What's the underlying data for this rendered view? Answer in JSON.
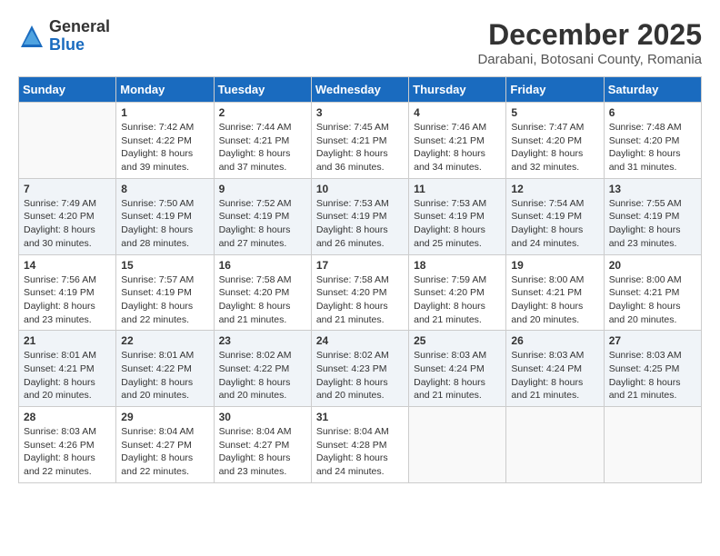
{
  "logo": {
    "general": "General",
    "blue": "Blue"
  },
  "header": {
    "month_year": "December 2025",
    "location": "Darabani, Botosani County, Romania"
  },
  "weekdays": [
    "Sunday",
    "Monday",
    "Tuesday",
    "Wednesday",
    "Thursday",
    "Friday",
    "Saturday"
  ],
  "weeks": [
    [
      {
        "day": "",
        "sunrise": "",
        "sunset": "",
        "daylight": ""
      },
      {
        "day": "1",
        "sunrise": "Sunrise: 7:42 AM",
        "sunset": "Sunset: 4:22 PM",
        "daylight": "Daylight: 8 hours and 39 minutes."
      },
      {
        "day": "2",
        "sunrise": "Sunrise: 7:44 AM",
        "sunset": "Sunset: 4:21 PM",
        "daylight": "Daylight: 8 hours and 37 minutes."
      },
      {
        "day": "3",
        "sunrise": "Sunrise: 7:45 AM",
        "sunset": "Sunset: 4:21 PM",
        "daylight": "Daylight: 8 hours and 36 minutes."
      },
      {
        "day": "4",
        "sunrise": "Sunrise: 7:46 AM",
        "sunset": "Sunset: 4:21 PM",
        "daylight": "Daylight: 8 hours and 34 minutes."
      },
      {
        "day": "5",
        "sunrise": "Sunrise: 7:47 AM",
        "sunset": "Sunset: 4:20 PM",
        "daylight": "Daylight: 8 hours and 32 minutes."
      },
      {
        "day": "6",
        "sunrise": "Sunrise: 7:48 AM",
        "sunset": "Sunset: 4:20 PM",
        "daylight": "Daylight: 8 hours and 31 minutes."
      }
    ],
    [
      {
        "day": "7",
        "sunrise": "Sunrise: 7:49 AM",
        "sunset": "Sunset: 4:20 PM",
        "daylight": "Daylight: 8 hours and 30 minutes."
      },
      {
        "day": "8",
        "sunrise": "Sunrise: 7:50 AM",
        "sunset": "Sunset: 4:19 PM",
        "daylight": "Daylight: 8 hours and 28 minutes."
      },
      {
        "day": "9",
        "sunrise": "Sunrise: 7:52 AM",
        "sunset": "Sunset: 4:19 PM",
        "daylight": "Daylight: 8 hours and 27 minutes."
      },
      {
        "day": "10",
        "sunrise": "Sunrise: 7:53 AM",
        "sunset": "Sunset: 4:19 PM",
        "daylight": "Daylight: 8 hours and 26 minutes."
      },
      {
        "day": "11",
        "sunrise": "Sunrise: 7:53 AM",
        "sunset": "Sunset: 4:19 PM",
        "daylight": "Daylight: 8 hours and 25 minutes."
      },
      {
        "day": "12",
        "sunrise": "Sunrise: 7:54 AM",
        "sunset": "Sunset: 4:19 PM",
        "daylight": "Daylight: 8 hours and 24 minutes."
      },
      {
        "day": "13",
        "sunrise": "Sunrise: 7:55 AM",
        "sunset": "Sunset: 4:19 PM",
        "daylight": "Daylight: 8 hours and 23 minutes."
      }
    ],
    [
      {
        "day": "14",
        "sunrise": "Sunrise: 7:56 AM",
        "sunset": "Sunset: 4:19 PM",
        "daylight": "Daylight: 8 hours and 23 minutes."
      },
      {
        "day": "15",
        "sunrise": "Sunrise: 7:57 AM",
        "sunset": "Sunset: 4:19 PM",
        "daylight": "Daylight: 8 hours and 22 minutes."
      },
      {
        "day": "16",
        "sunrise": "Sunrise: 7:58 AM",
        "sunset": "Sunset: 4:20 PM",
        "daylight": "Daylight: 8 hours and 21 minutes."
      },
      {
        "day": "17",
        "sunrise": "Sunrise: 7:58 AM",
        "sunset": "Sunset: 4:20 PM",
        "daylight": "Daylight: 8 hours and 21 minutes."
      },
      {
        "day": "18",
        "sunrise": "Sunrise: 7:59 AM",
        "sunset": "Sunset: 4:20 PM",
        "daylight": "Daylight: 8 hours and 21 minutes."
      },
      {
        "day": "19",
        "sunrise": "Sunrise: 8:00 AM",
        "sunset": "Sunset: 4:21 PM",
        "daylight": "Daylight: 8 hours and 20 minutes."
      },
      {
        "day": "20",
        "sunrise": "Sunrise: 8:00 AM",
        "sunset": "Sunset: 4:21 PM",
        "daylight": "Daylight: 8 hours and 20 minutes."
      }
    ],
    [
      {
        "day": "21",
        "sunrise": "Sunrise: 8:01 AM",
        "sunset": "Sunset: 4:21 PM",
        "daylight": "Daylight: 8 hours and 20 minutes."
      },
      {
        "day": "22",
        "sunrise": "Sunrise: 8:01 AM",
        "sunset": "Sunset: 4:22 PM",
        "daylight": "Daylight: 8 hours and 20 minutes."
      },
      {
        "day": "23",
        "sunrise": "Sunrise: 8:02 AM",
        "sunset": "Sunset: 4:22 PM",
        "daylight": "Daylight: 8 hours and 20 minutes."
      },
      {
        "day": "24",
        "sunrise": "Sunrise: 8:02 AM",
        "sunset": "Sunset: 4:23 PM",
        "daylight": "Daylight: 8 hours and 20 minutes."
      },
      {
        "day": "25",
        "sunrise": "Sunrise: 8:03 AM",
        "sunset": "Sunset: 4:24 PM",
        "daylight": "Daylight: 8 hours and 21 minutes."
      },
      {
        "day": "26",
        "sunrise": "Sunrise: 8:03 AM",
        "sunset": "Sunset: 4:24 PM",
        "daylight": "Daylight: 8 hours and 21 minutes."
      },
      {
        "day": "27",
        "sunrise": "Sunrise: 8:03 AM",
        "sunset": "Sunset: 4:25 PM",
        "daylight": "Daylight: 8 hours and 21 minutes."
      }
    ],
    [
      {
        "day": "28",
        "sunrise": "Sunrise: 8:03 AM",
        "sunset": "Sunset: 4:26 PM",
        "daylight": "Daylight: 8 hours and 22 minutes."
      },
      {
        "day": "29",
        "sunrise": "Sunrise: 8:04 AM",
        "sunset": "Sunset: 4:27 PM",
        "daylight": "Daylight: 8 hours and 22 minutes."
      },
      {
        "day": "30",
        "sunrise": "Sunrise: 8:04 AM",
        "sunset": "Sunset: 4:27 PM",
        "daylight": "Daylight: 8 hours and 23 minutes."
      },
      {
        "day": "31",
        "sunrise": "Sunrise: 8:04 AM",
        "sunset": "Sunset: 4:28 PM",
        "daylight": "Daylight: 8 hours and 24 minutes."
      },
      {
        "day": "",
        "sunrise": "",
        "sunset": "",
        "daylight": ""
      },
      {
        "day": "",
        "sunrise": "",
        "sunset": "",
        "daylight": ""
      },
      {
        "day": "",
        "sunrise": "",
        "sunset": "",
        "daylight": ""
      }
    ]
  ]
}
